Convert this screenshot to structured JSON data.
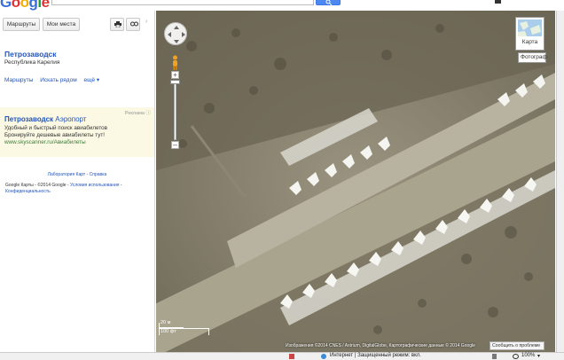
{
  "logo": {
    "letters": [
      "G",
      "o",
      "o",
      "g",
      "l",
      "e"
    ]
  },
  "search": {
    "placeholder": "",
    "value": ""
  },
  "sidebar": {
    "routes_btn": "Маршруты",
    "places_btn": "Мои места",
    "title": "Петрозаводск",
    "subtitle": "Республика Карелия",
    "links": [
      "Маршруты",
      "Искать рядом",
      "ещё ▾"
    ],
    "ad": {
      "label": "Реклама ⓘ",
      "title_bold": "Петрозаводск",
      "title_rest": " Аэропорт",
      "line1": "Удобный и быстрый поиск авиабилетов",
      "line2": "Бронируйте дешевые авиабилеты тут!",
      "url": "www.skyscanner.ru/Авиабилеты"
    },
    "footer_links": "Лаборатория Карт - Справка",
    "footer_brand": "Google Карты",
    "footer_copy": " - ©2014 Google - ",
    "footer_terms": "Условия использования",
    "footer_privacy": "Конфиденциальность"
  },
  "map": {
    "maptype_label": "Карта",
    "photo_label": "Фотограф",
    "scale_metric": "20 м",
    "scale_imperial": "100 фт",
    "attribution": "Изображения ©2014 CNES / Astrium, DigitalGlobe, Картографические данные © 2014 Google",
    "report_btn": "Сообщить о проблеме"
  },
  "statusbar": {
    "status": "Интернет | Защищенный режим: вкл.",
    "zoom": "100%",
    "zoom_arrow": "▾"
  },
  "colors": {
    "accent": "#2255bb",
    "ad_bg": "#fbf8e3",
    "search_btn": "#4d88f0"
  }
}
